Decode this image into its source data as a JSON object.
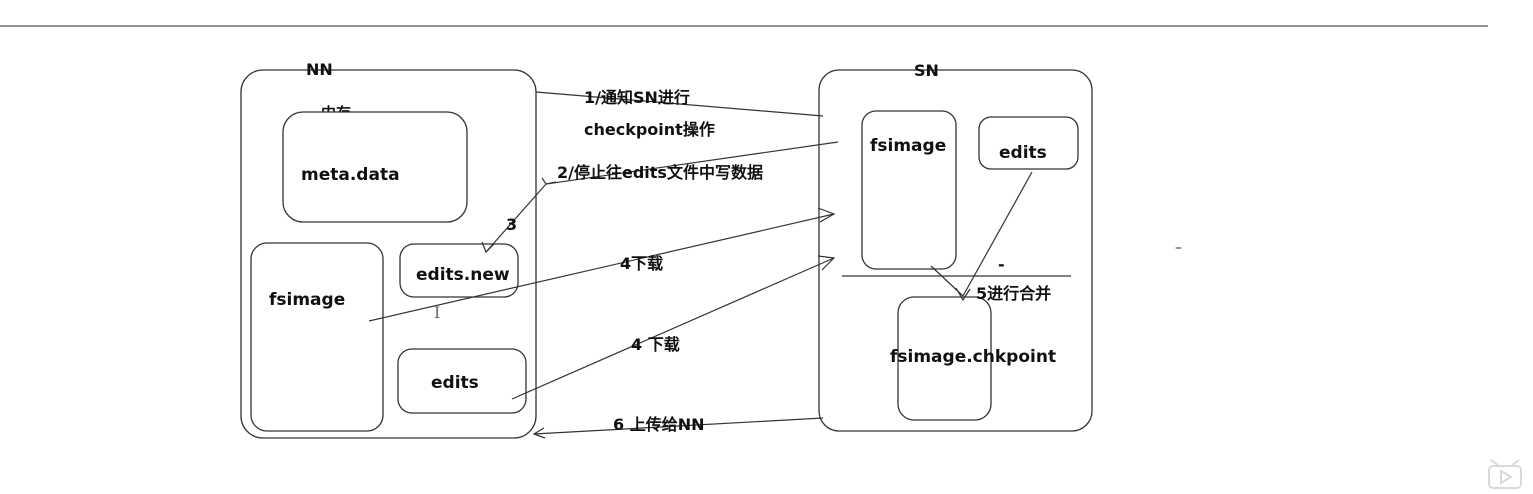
{
  "diagram": {
    "nn": {
      "title": "NN",
      "memory_label": "内存",
      "meta": "meta.data",
      "fsimage": "fsimage",
      "edits_new": "edits.new",
      "edits": "edits"
    },
    "sn": {
      "title": "SN",
      "fsimage": "fsimage",
      "edits": "edits",
      "chkpoint": "fsimage.chkpoint",
      "dash": "-"
    },
    "steps": {
      "s1_line1": "1/通知SN进行",
      "s1_line2": "checkpoint操作",
      "s2": "2/停止往edits文件中写数据",
      "s3": "3",
      "s4a": "4下载",
      "s4b": "4 下载",
      "s5": "5进行合并",
      "s6": "6 上传给NN"
    },
    "stray_dash": "–",
    "cursor_glyph": "I"
  },
  "player": {
    "icon": "play-icon"
  }
}
